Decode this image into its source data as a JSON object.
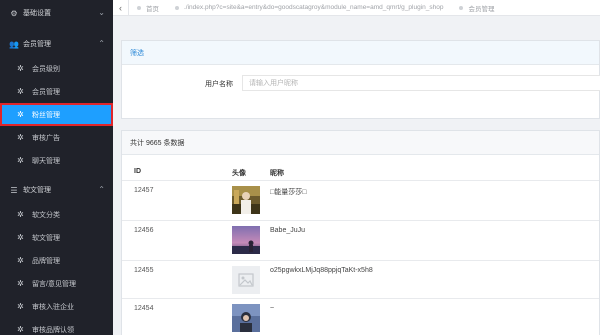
{
  "sidebar": {
    "groups": [
      {
        "label": "基础设置",
        "items": []
      },
      {
        "label": "会员管理",
        "items": [
          "会员级别",
          "会员管理",
          "粉丝管理",
          "审核广告",
          "聊天管理"
        ]
      },
      {
        "label": "软文管理",
        "items": [
          "软文分类",
          "软文管理",
          "品牌管理",
          "留言/意见管理",
          "审核入驻企业",
          "审核品牌认领"
        ]
      }
    ],
    "active_item": "粉丝管理"
  },
  "tabbar": {
    "back_glyph": "‹",
    "tabs": [
      {
        "label": "首页"
      },
      {
        "label": "./index.php?c=site&a=entry&do=goodscatagroy&module_name=amd_qmrt/g_plugin_shop"
      },
      {
        "label": "会员管理"
      }
    ]
  },
  "filter": {
    "title": "筛选",
    "field_label": "用户名称",
    "field_value": "",
    "field_placeholder": "请输入用户昵称"
  },
  "table": {
    "summary": "共计 9665 条数据",
    "columns": {
      "id": "ID",
      "avatar": "头像",
      "nickname": "昵称"
    },
    "rows": [
      {
        "id": "12457",
        "nickname": "□能量莎莎□",
        "avatar": "photo-outdoor"
      },
      {
        "id": "12456",
        "nickname": "Babe_JuJu",
        "avatar": "photo-sunset"
      },
      {
        "id": "12455",
        "nickname": "o25pgwkxLMjJq88ppjqTaKt-x5h8",
        "avatar": "placeholder-image"
      },
      {
        "id": "12454",
        "nickname": "~",
        "avatar": "photo-portrait"
      }
    ]
  },
  "colors": {
    "sidebar_bg": "#20222a",
    "active_bg": "#1e9fff",
    "highlight_border": "#e0252a",
    "panel_head_text": "#2f8ad8"
  }
}
